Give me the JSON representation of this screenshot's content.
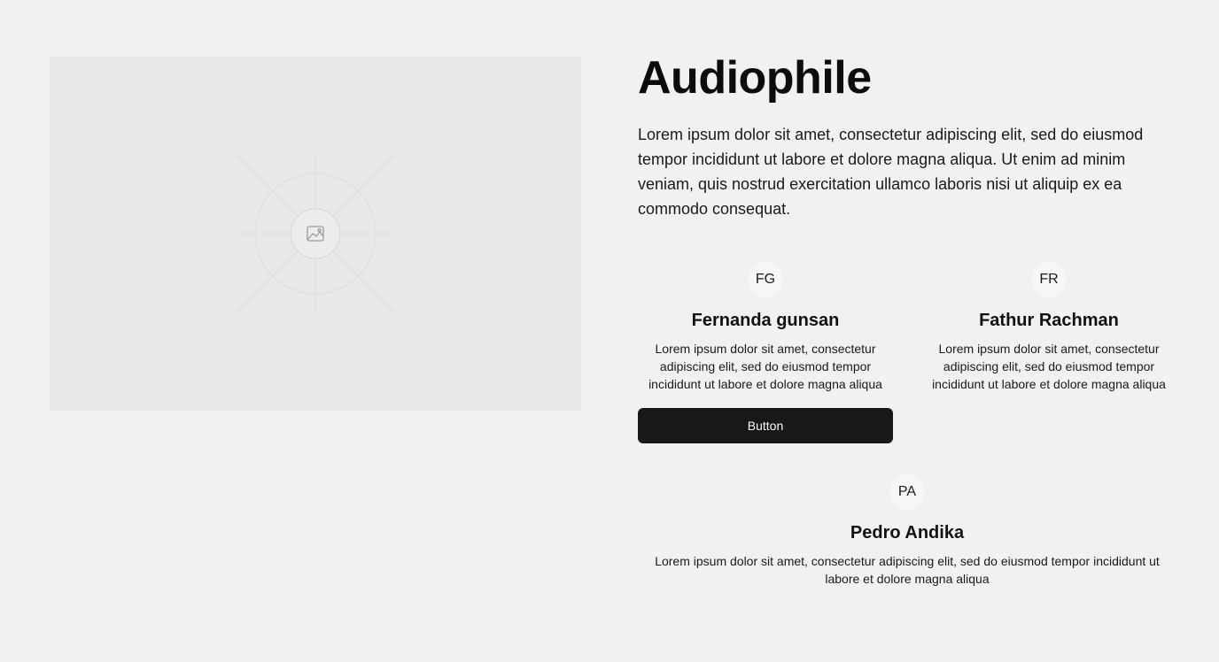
{
  "hero": {
    "title": "Audiophile",
    "description": "Lorem ipsum dolor sit amet, consectetur adipiscing elit, sed do eiusmod tempor incididunt ut labore et dolore magna aliqua. Ut enim ad minim veniam, quis nostrud exercitation ullamco laboris nisi ut aliquip ex ea commodo consequat.",
    "image_icon": "image-icon"
  },
  "cards": [
    {
      "initials": "FG",
      "name": "Fernanda gunsan",
      "description": "Lorem ipsum dolor sit amet, consectetur adipiscing elit, sed do eiusmod tempor incididunt ut labore et dolore magna aliqua",
      "button_label": "Button"
    },
    {
      "initials": "FR",
      "name": "Fathur Rachman",
      "description": "Lorem ipsum dolor sit amet, consectetur adipiscing elit, sed do eiusmod tempor incididunt ut labore et dolore magna aliqua"
    },
    {
      "initials": "PA",
      "name": "Pedro Andika",
      "description": "Lorem ipsum dolor sit amet, consectetur adipiscing elit, sed do eiusmod tempor incididunt ut labore et dolore magna aliqua"
    }
  ],
  "colors": {
    "background": "#f1f1f1",
    "placeholder": "#e8e8e8",
    "button": "#18181b",
    "button_text": "#fafafa"
  }
}
